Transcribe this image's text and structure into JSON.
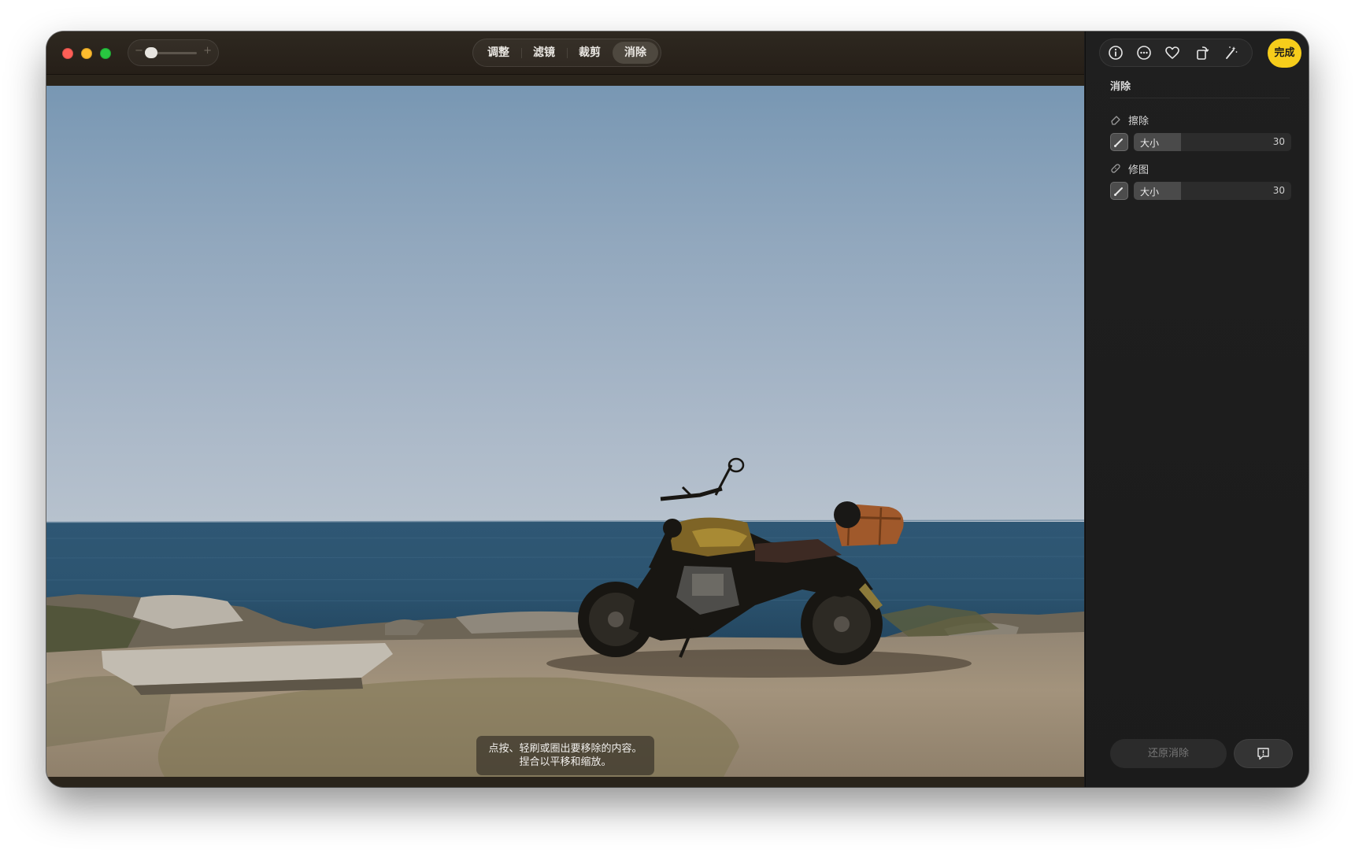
{
  "window": {
    "traffic_lights": [
      "close",
      "minimize",
      "zoom"
    ]
  },
  "zoom_control": {
    "minus": "−",
    "plus": "+",
    "level": 0.0
  },
  "edit_tabs": {
    "active": "消除",
    "items": [
      "调整",
      "滤镜",
      "裁剪",
      "消除"
    ]
  },
  "photo": {
    "subject": "motorcycle parked on rocky coast by the sea",
    "hint_line1": "点按、轻刷或圈出要移除的内容。",
    "hint_line2": "捏合以平移和缩放。"
  },
  "toolbar": {
    "icons": [
      "info-icon",
      "more-icon",
      "heart-icon",
      "rotate-icon",
      "magic-wand-icon"
    ],
    "done_label": "完成",
    "done_color": "#f6cd1b"
  },
  "sidebar": {
    "title": "消除",
    "tools": [
      {
        "icon": "eraser-icon",
        "label": "擦除",
        "size_label": "大小",
        "size_value": "30",
        "size_fraction": 0.3
      },
      {
        "icon": "bandage-icon",
        "label": "修图",
        "size_label": "大小",
        "size_value": "30",
        "size_fraction": 0.3
      }
    ],
    "revert_label": "还原消除",
    "feedback_icon": "feedback-icon"
  }
}
